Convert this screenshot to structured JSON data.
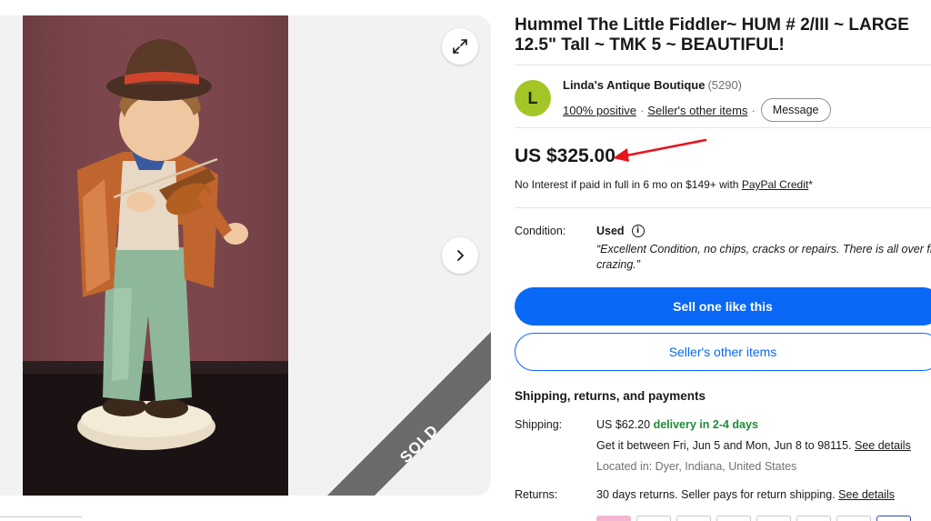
{
  "listing": {
    "title": "Hummel The Little Fiddler~ HUM # 2/III ~ LARGE 12.5\" Tall ~ TMK 5 ~ BEAUTIFUL!",
    "sold_label": "SOLD"
  },
  "gallery": {
    "expand_icon": "expand-icon",
    "next_icon": "chevron-right-icon"
  },
  "seller": {
    "avatar_letter": "L",
    "avatar_color": "#a3c626",
    "name": "Linda's Antique Boutique",
    "feedback_count": "(5290)",
    "positive": "100% positive",
    "other_items_link": "Seller's other items",
    "message_button": "Message"
  },
  "pricing": {
    "price": "US $325.00",
    "financing_text": "No Interest if paid in full in 6 mo on $149+ with",
    "financing_link": "PayPal Credit",
    "financing_suffix": "*"
  },
  "condition": {
    "label": "Condition:",
    "value": "Used",
    "quote_line1": "“Excellent Condition, no chips, cracks or repairs. There is all over fi",
    "quote_line2": "crazing.”"
  },
  "actions": {
    "primary": "Sell one like this",
    "secondary": "Seller's other items"
  },
  "shipping": {
    "heading": "Shipping, returns, and payments",
    "label": "Shipping:",
    "cost": "US $62.20",
    "delivery": "delivery in 2-4 days",
    "estimate": "Get it between Fri, Jun 5 and Mon, Jun 8 to 98115.",
    "see_details": "See details",
    "location": "Located in: Dyer, Indiana, United States"
  },
  "returns": {
    "label": "Returns:",
    "text": "30 days returns. Seller pays for return shipping.",
    "see_details": "See details"
  },
  "colors": {
    "accent_blue": "#0968f6",
    "delivery_green": "#1e8a37",
    "annotation_red": "#e8141c",
    "sold_ribbon": "#6b6b6b"
  }
}
